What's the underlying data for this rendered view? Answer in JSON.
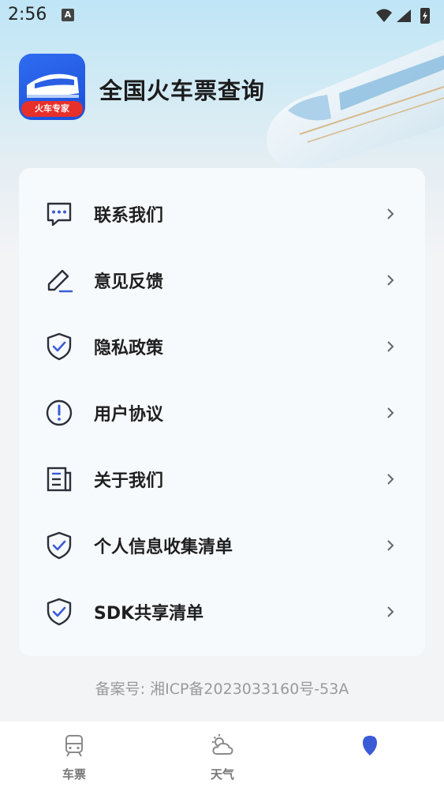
{
  "status_bar": {
    "time": "2:56",
    "input_badge": "A"
  },
  "header": {
    "app_title": "全国火车票查询",
    "logo_ribbon": "火车专家"
  },
  "menu": {
    "items": [
      {
        "label": "联系我们",
        "icon": "chat-icon"
      },
      {
        "label": "意见反馈",
        "icon": "edit-icon"
      },
      {
        "label": "隐私政策",
        "icon": "shield-check-icon"
      },
      {
        "label": "用户协议",
        "icon": "alert-circle-icon"
      },
      {
        "label": "关于我们",
        "icon": "document-icon"
      },
      {
        "label": "个人信息收集清单",
        "icon": "shield-check-icon"
      },
      {
        "label": "SDK共享清单",
        "icon": "shield-check-icon"
      }
    ]
  },
  "footer": {
    "icp": "备案号: 湘ICP备2023033160号-53A"
  },
  "tabs": [
    {
      "label": "车票",
      "icon": "train-icon"
    },
    {
      "label": "天气",
      "icon": "weather-icon"
    },
    {
      "label": "",
      "icon": "location-icon",
      "active": true
    }
  ],
  "colors": {
    "accent": "#3b5bd6",
    "icon_stroke": "#2b2f3a",
    "brand_red": "#e8302a"
  }
}
